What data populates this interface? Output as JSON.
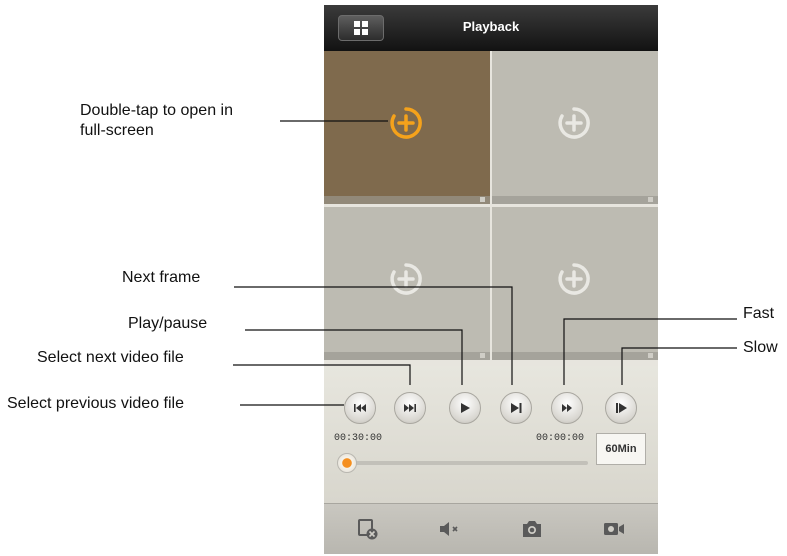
{
  "header": {
    "title": "Playback",
    "menu_icon": "grid-icon"
  },
  "panes": [
    {
      "state": "selected",
      "icon": "add-channel-icon"
    },
    {
      "state": "empty",
      "icon": "add-channel-icon"
    },
    {
      "state": "empty",
      "icon": "add-channel-icon"
    },
    {
      "state": "empty",
      "icon": "add-channel-icon"
    }
  ],
  "controls": {
    "buttons": [
      {
        "name": "previous-file-button",
        "icon": "skip-back-icon"
      },
      {
        "name": "next-file-button",
        "icon": "skip-forward-icon"
      },
      {
        "name": "play-pause-button",
        "icon": "play-icon"
      },
      {
        "name": "next-frame-button",
        "icon": "step-forward-icon"
      },
      {
        "name": "fast-button",
        "icon": "fast-forward-icon"
      },
      {
        "name": "slow-button",
        "icon": "slow-play-icon"
      }
    ],
    "start_time": "00:30:00",
    "end_time": "00:00:00",
    "duration_label": "60Min",
    "progress": 0
  },
  "toolbar": {
    "icons": [
      "close-camera-icon",
      "mute-icon",
      "snapshot-icon",
      "record-icon"
    ]
  },
  "callouts": {
    "double_tap_line1": "Double-tap to open in",
    "double_tap_line2": "full-screen",
    "next_frame": "Next frame",
    "play_pause": "Play/pause",
    "select_next": "Select next video file",
    "select_previous": "Select previous video file",
    "fast": "Fast",
    "slow": "Slow"
  },
  "colors": {
    "accent": "#f5a21b",
    "header": "#1a1a1a",
    "selected_pane": "#7f6a4d"
  }
}
